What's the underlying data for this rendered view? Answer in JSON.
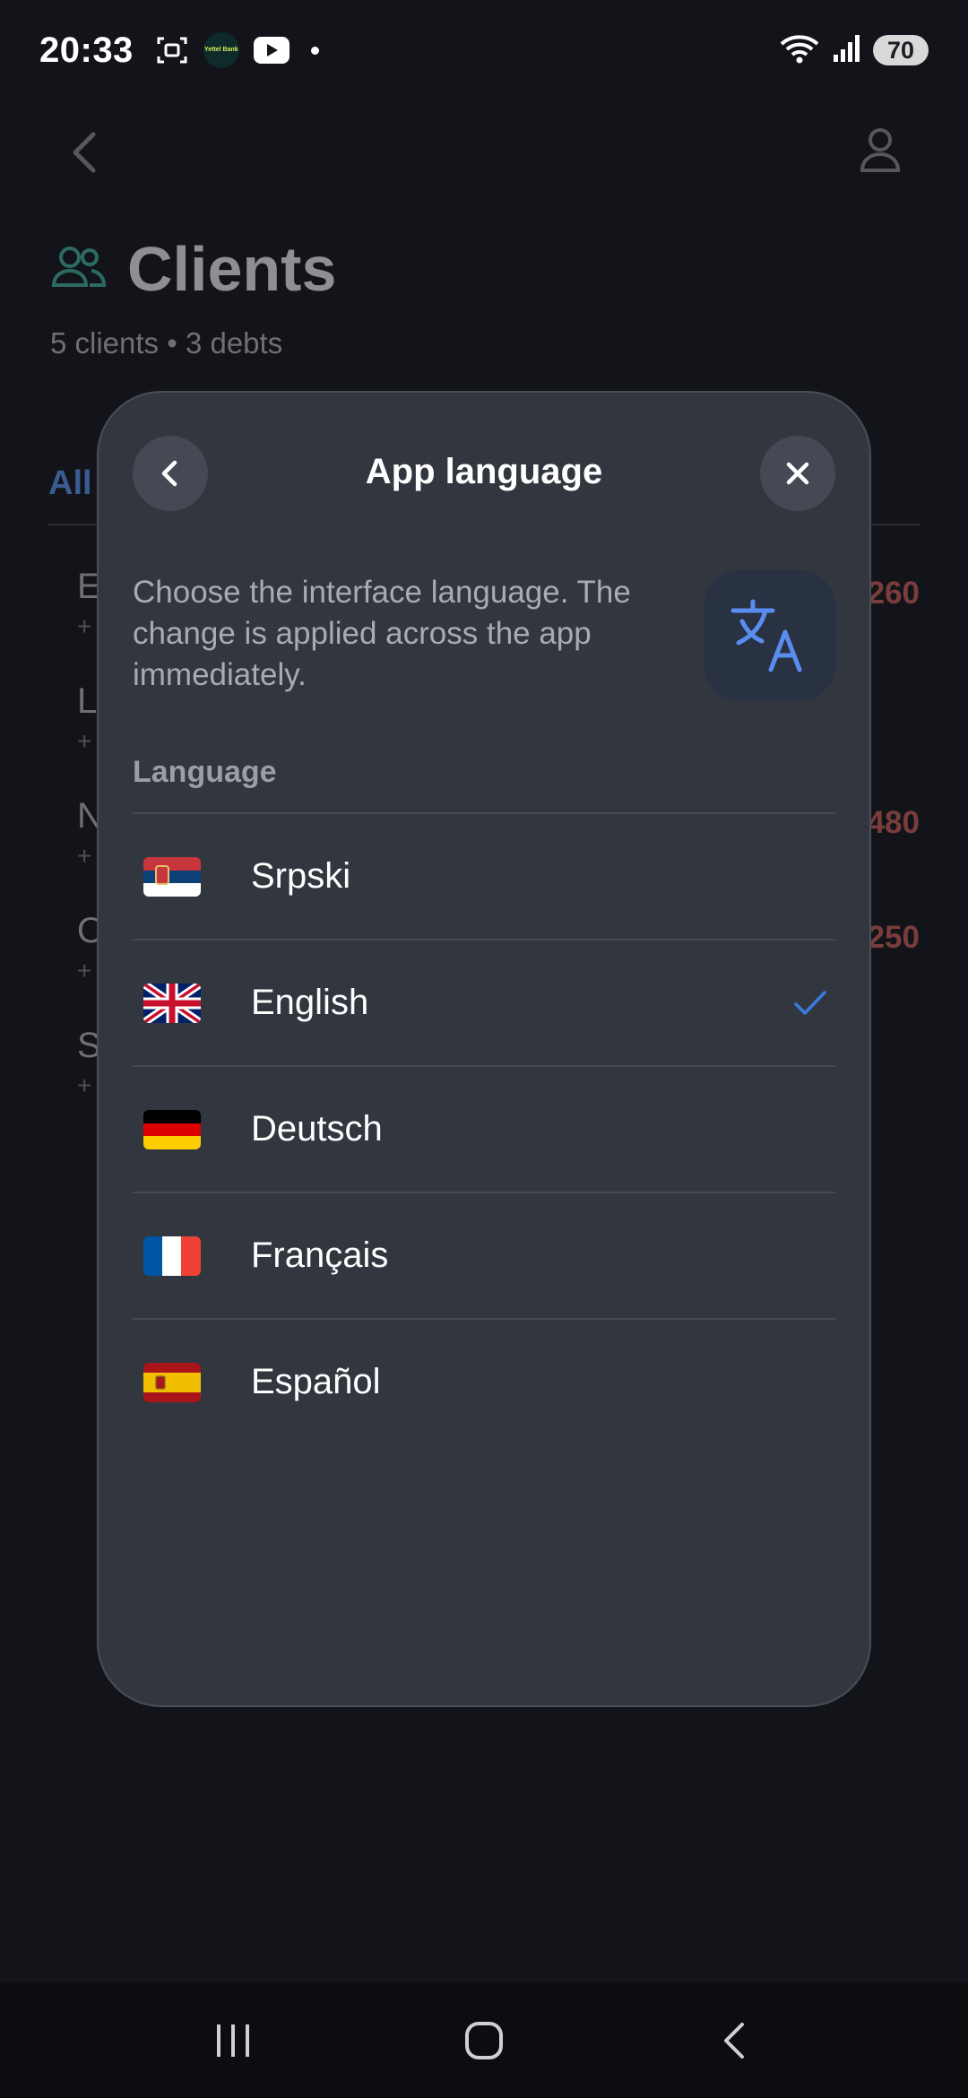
{
  "status_bar": {
    "time": "20:33",
    "bank_icon_text": "Yettel Bank",
    "battery": "70"
  },
  "background": {
    "title": "Clients",
    "subtitle": "5 clients • 3 debts",
    "tab_all": "All",
    "rows": [
      {
        "initial": "E",
        "phone": "+",
        "amount": "260"
      },
      {
        "initial": "L",
        "phone": "+",
        "amount": ""
      },
      {
        "initial": "N",
        "phone": "+",
        "amount": "480"
      },
      {
        "initial": "O",
        "phone": "+",
        "amount": "250"
      },
      {
        "initial": "S",
        "phone": "+",
        "amount": ""
      }
    ]
  },
  "modal": {
    "title": "App language",
    "description": "Choose the interface language. The change is applied across the app immediately.",
    "section_label": "Language",
    "languages": [
      {
        "name": "Srpski",
        "flag": "serbia-flag",
        "selected": false
      },
      {
        "name": "English",
        "flag": "uk-flag",
        "selected": true
      },
      {
        "name": "Deutsch",
        "flag": "germany-flag",
        "selected": false
      },
      {
        "name": "Français",
        "flag": "france-flag",
        "selected": false
      },
      {
        "name": "Español",
        "flag": "spain-flag",
        "selected": false
      }
    ]
  },
  "colors": {
    "accent": "#3b7be0",
    "debt": "#7a3c3c",
    "modal_bg": "#32363f",
    "page_bg": "#121419"
  }
}
